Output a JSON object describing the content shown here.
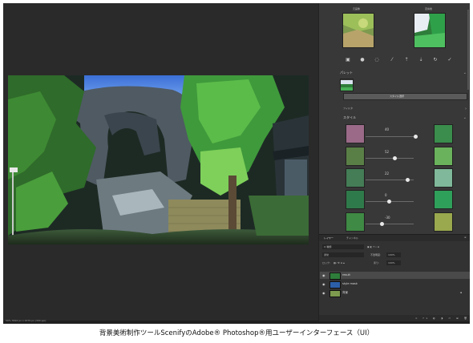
{
  "caption": "背景美術制作ツールScenifyのAdobe® Photoshop®用ユーザーインターフェース（UI）",
  "status_bar": {
    "info": "50%   3992 px x 2279 px (300 ppi)"
  },
  "panel": {
    "top_labels": [
      "元画像",
      "変換後"
    ],
    "palette_label": "パレット",
    "style_select_button": "スタイル選択",
    "filter_label": "フィルタ",
    "style_label": "スタイル",
    "style_values": [
      "40",
      "52",
      "22",
      "0",
      "-30"
    ]
  },
  "layers_panel": {
    "tabs": [
      "レイヤー",
      "チャンネル"
    ],
    "filter_kind": "Q 種類",
    "blend_mode": "通常",
    "opacity_label": "不透明度:",
    "opacity_value": "100%",
    "lock_label": "ロック:",
    "fill_label": "塗り:",
    "fill_value": "100%",
    "layers": [
      {
        "name": "result",
        "selected": true
      },
      {
        "name": "style mask",
        "selected": false
      },
      {
        "name": "背景",
        "selected": false
      }
    ]
  },
  "colors": {
    "app_bg": "#303030",
    "panel_bg": "#383838",
    "canvas_bg": "#2a2a2a",
    "selected_layer": "#4a4a4a"
  }
}
